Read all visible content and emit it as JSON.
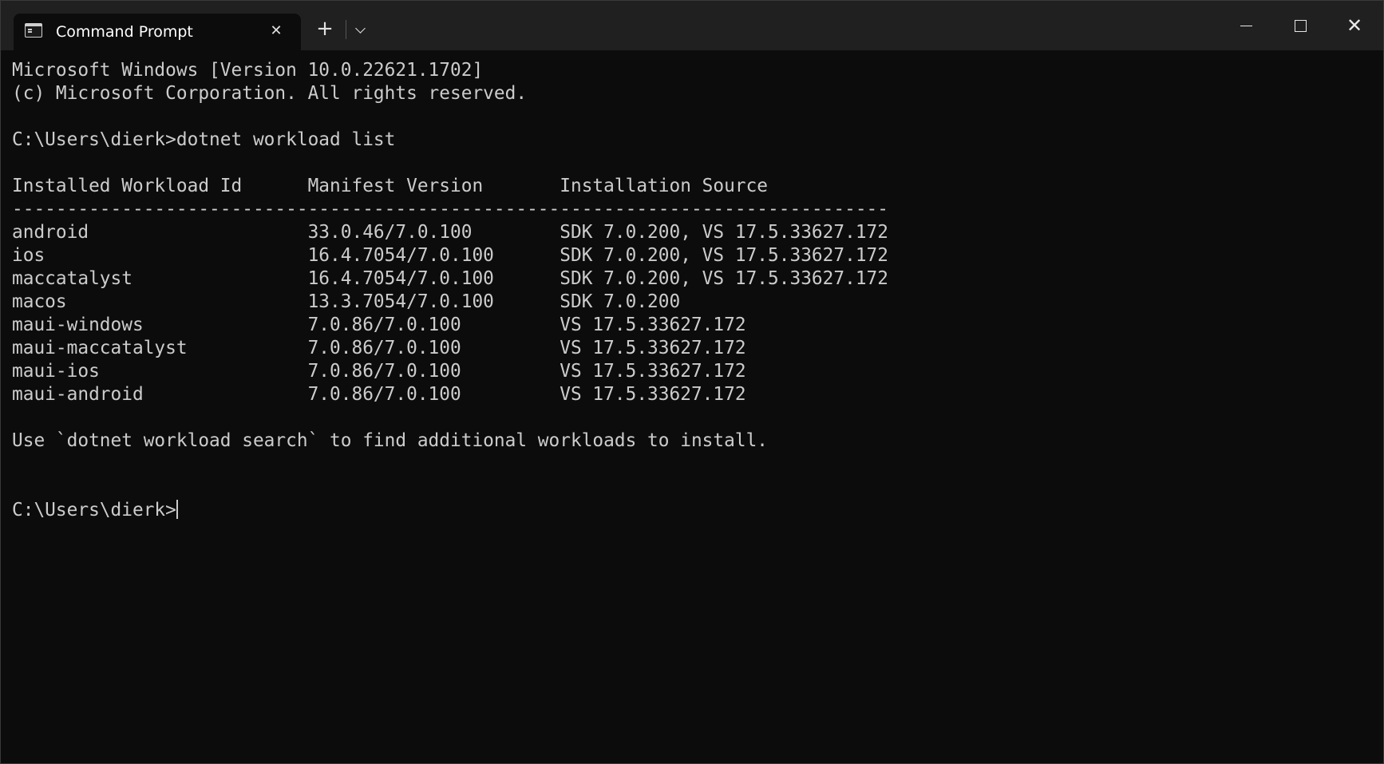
{
  "window": {
    "tab_title": "Command Prompt",
    "tab_icon": "terminal-icon",
    "tab_close_icon": "close-icon",
    "new_tab_icon": "plus-icon",
    "dropdown_icon": "chevron-down-icon",
    "minimize_icon": "minimize-icon",
    "maximize_icon": "maximize-icon",
    "close_icon": "close-icon"
  },
  "terminal": {
    "lines": [
      "Microsoft Windows [Version 10.0.22621.1702]",
      "(c) Microsoft Corporation. All rights reserved.",
      "",
      "C:\\Users\\dierk>dotnet workload list",
      "",
      "Installed Workload Id      Manifest Version       Installation Source",
      "--------------------------------------------------------------------------------",
      "android                    33.0.46/7.0.100        SDK 7.0.200, VS 17.5.33627.172",
      "ios                        16.4.7054/7.0.100      SDK 7.0.200, VS 17.5.33627.172",
      "maccatalyst                16.4.7054/7.0.100      SDK 7.0.200, VS 17.5.33627.172",
      "macos                      13.3.7054/7.0.100      SDK 7.0.200",
      "maui-windows               7.0.86/7.0.100         VS 17.5.33627.172",
      "maui-maccatalyst           7.0.86/7.0.100         VS 17.5.33627.172",
      "maui-ios                   7.0.86/7.0.100         VS 17.5.33627.172",
      "maui-android               7.0.86/7.0.100         VS 17.5.33627.172",
      "",
      "Use `dotnet workload search` to find additional workloads to install.",
      "",
      ""
    ],
    "prompt": "C:\\Users\\dierk>"
  }
}
